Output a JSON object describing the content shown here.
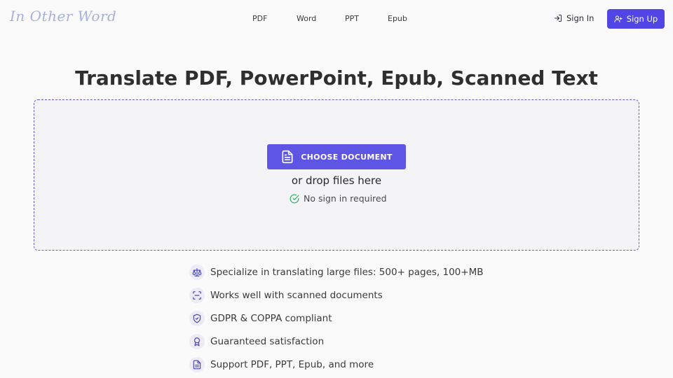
{
  "header": {
    "logo_text": "In Other Word",
    "nav": [
      "PDF",
      "Word",
      "PPT",
      "Epub"
    ],
    "sign_in_label": "Sign In",
    "sign_up_label": "Sign Up"
  },
  "main": {
    "title": "Translate PDF, PowerPoint, Epub, Scanned Text",
    "choose_document_label": "CHOOSE DOCUMENT",
    "drop_text": "or drop files here",
    "no_sign_in_text": "No sign in required"
  },
  "features": [
    {
      "icon": "scale-icon",
      "text": "Specialize in translating large files: 500+ pages, 100+MB"
    },
    {
      "icon": "scan-icon",
      "text": "Works well with scanned documents"
    },
    {
      "icon": "shield-check-icon",
      "text": "GDPR & COPPA compliant"
    },
    {
      "icon": "award-icon",
      "text": "Guaranteed satisfaction"
    },
    {
      "icon": "file-text-icon",
      "text": "Support PDF, PPT, Epub, and more"
    }
  ],
  "colors": {
    "accent": "#5146e5",
    "button": "#5f55e4",
    "logo": "#a7b0db",
    "success": "#3ab072"
  }
}
